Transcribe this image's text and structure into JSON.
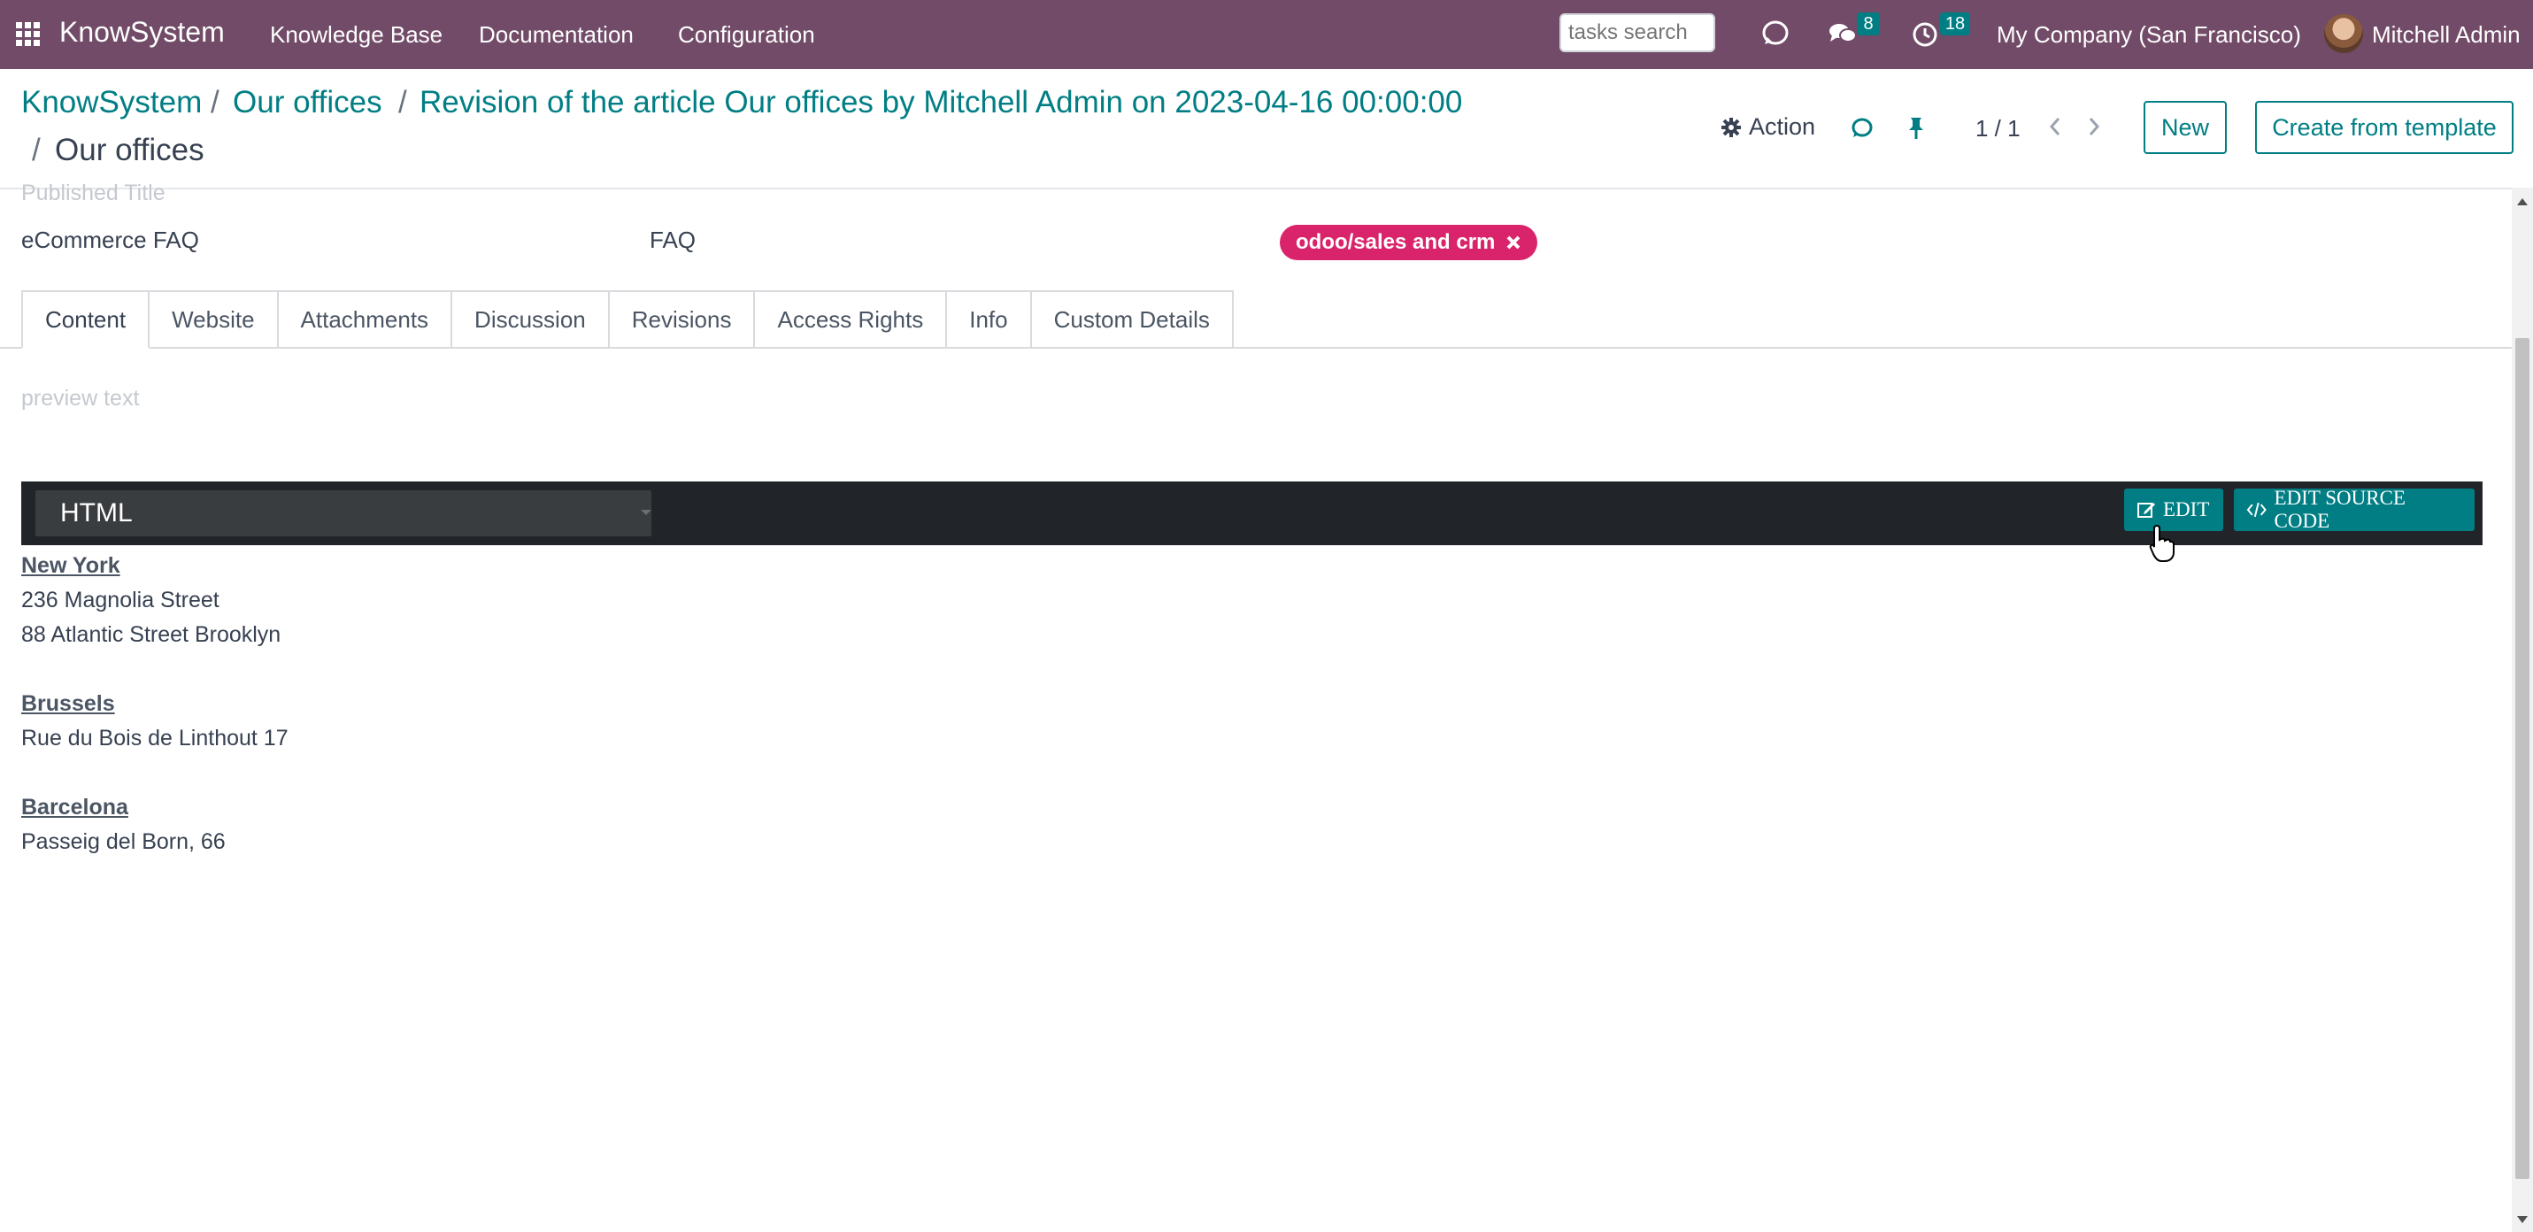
{
  "navbar": {
    "brand": "KnowSystem",
    "menus": [
      "Knowledge Base",
      "Documentation",
      "Configuration"
    ],
    "search_placeholder": "tasks search",
    "messages_count": "8",
    "activities_count": "18",
    "company": "My Company (San Francisco)",
    "user": "Mitchell Admin"
  },
  "breadcrumb": {
    "items": [
      "KnowSystem",
      "Our offices",
      "Revision of the article Our offices by Mitchell Admin on 2023-04-16 00:00:00"
    ],
    "separator": "/",
    "current": "Our offices"
  },
  "control": {
    "action_label": "Action",
    "pager": "1 / 1",
    "new_label": "New",
    "template_label": "Create from template"
  },
  "form": {
    "published_title_label": "Published Title",
    "field_left": "eCommerce FAQ",
    "field_middle": "FAQ",
    "tag": "odoo/sales and crm",
    "tabs": [
      "Content",
      "Website",
      "Attachments",
      "Discussion",
      "Revisions",
      "Access Rights",
      "Info",
      "Custom Details"
    ],
    "preview_placeholder": "preview text",
    "editor": {
      "language": "HTML",
      "edit_label": "EDIT",
      "edit_source_label": "EDIT SOURCE CODE"
    },
    "offices": [
      {
        "city": "New York",
        "lines": [
          "236 Magnolia Street",
          "88 Atlantic Street Brooklyn"
        ]
      },
      {
        "city": "Brussels",
        "lines": [
          "Rue du Bois de Linthout 17"
        ]
      },
      {
        "city": "Barcelona",
        "lines": [
          "Passeig del Born, 66"
        ]
      }
    ]
  },
  "colors": {
    "navbar": "#714b67",
    "accent": "#017e84",
    "tag": "#d9246b",
    "editor_bar": "#212529"
  }
}
